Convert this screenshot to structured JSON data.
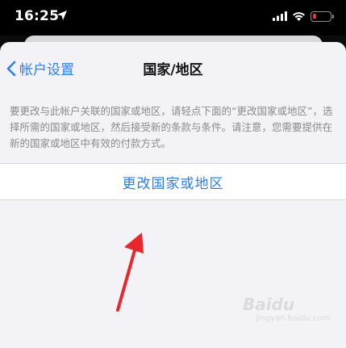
{
  "status_bar": {
    "time": "16:25",
    "icons": [
      "location-arrow-icon",
      "signal-icon",
      "wifi-icon",
      "battery-low-icon"
    ],
    "battery_color": "#e5342f"
  },
  "nav": {
    "back_label": "帐户设置",
    "title": "国家/地区"
  },
  "description": "要更改与此帐户关联的国家或地区，请轻点下面的“更改国家或地区”，选择所需的国家或地区，然后接受新的条款与条件。请注意，您需要提供在新的国家或地区中有效的付款方式。",
  "action": {
    "label": "更改国家或地区"
  },
  "annotation": {
    "arrow_color": "#e8262b"
  },
  "watermark": {
    "brand": "Baidu",
    "domain": "jingyan.baidu.com"
  },
  "colors": {
    "accent": "#2c7df7",
    "background": "#f2f2f7"
  }
}
